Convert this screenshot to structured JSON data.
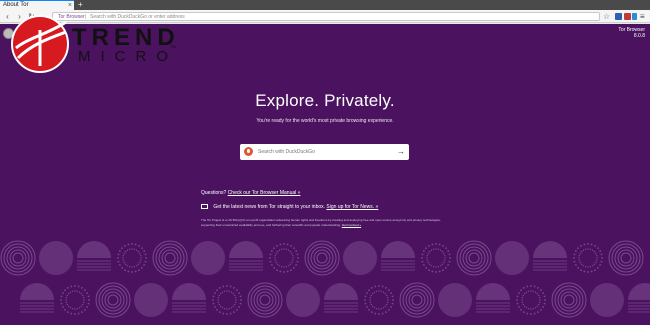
{
  "browser": {
    "tab_title": "About Tor",
    "tab_close": "×",
    "new_tab": "+",
    "nav": {
      "back": "‹",
      "forward": "›",
      "reload": "↻"
    },
    "url_identity": "Tor Browser",
    "url_placeholder": "Search with DuckDuckGo or enter address",
    "bookmark_star": "☆",
    "menu": "≡",
    "toolbar_icon_colors": [
      "#2f5fb3",
      "#c23b3b",
      "#2a8fcf"
    ]
  },
  "page": {
    "version_line1": "Tor Browser",
    "version_line2": "8.0.8",
    "headline": "Explore. Privately.",
    "subheadline": "You're ready for the world's most private browsing experience.",
    "search_placeholder": "Search with DuckDuckGo",
    "search_arrow": "→",
    "questions_prefix": "Questions?",
    "manual_link": "Check our Tor Browser Manual »",
    "news_text": "Get the latest news from Tor straight to your inbox.",
    "news_link": "Sign up for Tor News. »",
    "fine_print": "The Tor Project is a US 501(c)(3) non-profit organization advancing human rights and freedoms by creating and deploying free and open source anonymity and privacy technologies, supporting their unrestricted availability and use, and furthering their scientific and popular understanding.",
    "fine_print_link": "Get Involved »",
    "background_color": "#4b125f",
    "pattern_color": "#7a4a8c"
  },
  "overlay_logo": {
    "word1": "TREND",
    "word2": "MICRO",
    "tm": "TM",
    "primary_color": "#d71920"
  }
}
